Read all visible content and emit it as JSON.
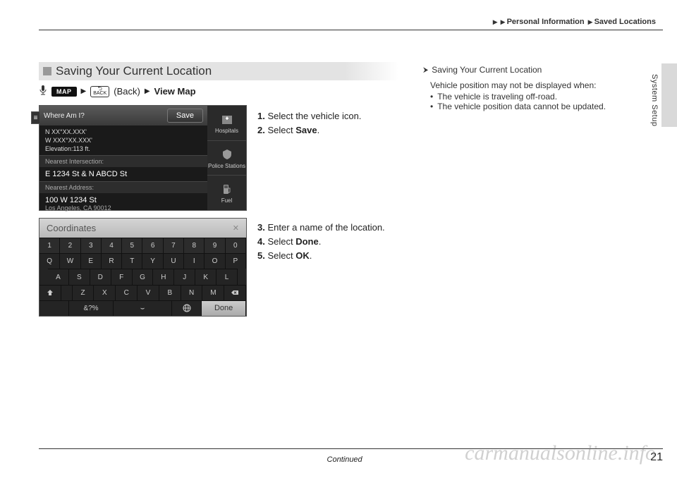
{
  "breadcrumb": {
    "a": "Personal Information",
    "b": "Saved Locations"
  },
  "side_tab": "System Setup",
  "section_title": "Saving Your Current Location",
  "path": {
    "map": "MAP",
    "back": "(Back)",
    "view": "View Map"
  },
  "ss1": {
    "hdr": "Where Am I?",
    "lat": "N XX°XX.XXX'",
    "lon": "W XXX°XX.XXX'",
    "elev": "Elevation:113 ft.",
    "save": "Save",
    "nearest_int_label": "Nearest Intersection:",
    "nearest_int": "E 1234 St & N ABCD St",
    "nearest_addr_label": "Nearest Address:",
    "nearest_addr": "100 W 1234 St",
    "city": "Los Angeles, CA 90012",
    "side": {
      "hospitals": "Hospitals",
      "police": "Police Stations",
      "fuel": "Fuel"
    }
  },
  "ss2": {
    "title": "Coordinates",
    "nums": [
      "1",
      "2",
      "3",
      "4",
      "5",
      "6",
      "7",
      "8",
      "9",
      "0"
    ],
    "row1": [
      "Q",
      "W",
      "E",
      "R",
      "T",
      "Y",
      "U",
      "I",
      "O",
      "P"
    ],
    "row2": [
      "A",
      "S",
      "D",
      "F",
      "G",
      "H",
      "J",
      "K",
      "L"
    ],
    "row3": [
      "Z",
      "X",
      "C",
      "V",
      "B",
      "N",
      "M"
    ],
    "sym": "&?%",
    "done": "Done"
  },
  "instr": {
    "s1n": "1.",
    "s1": " Select the vehicle icon.",
    "s2n": "2.",
    "s2": " Select ",
    "s2b": "Save",
    "s2e": ".",
    "s3n": "3.",
    "s3": " Enter a name of the location.",
    "s4n": "4.",
    "s4": " Select ",
    "s4b": "Done",
    "s4e": ".",
    "s5n": "5.",
    "s5": " Select ",
    "s5b": "OK",
    "s5e": "."
  },
  "tip": {
    "title": "Saving Your Current Location",
    "l1": "Vehicle position may not be displayed when:",
    "b1": "The vehicle is traveling off-road.",
    "b2": "The vehicle position data cannot be updated."
  },
  "footer": {
    "cont": "Continued",
    "page": "21"
  },
  "watermark": "carmanualsonline.info"
}
